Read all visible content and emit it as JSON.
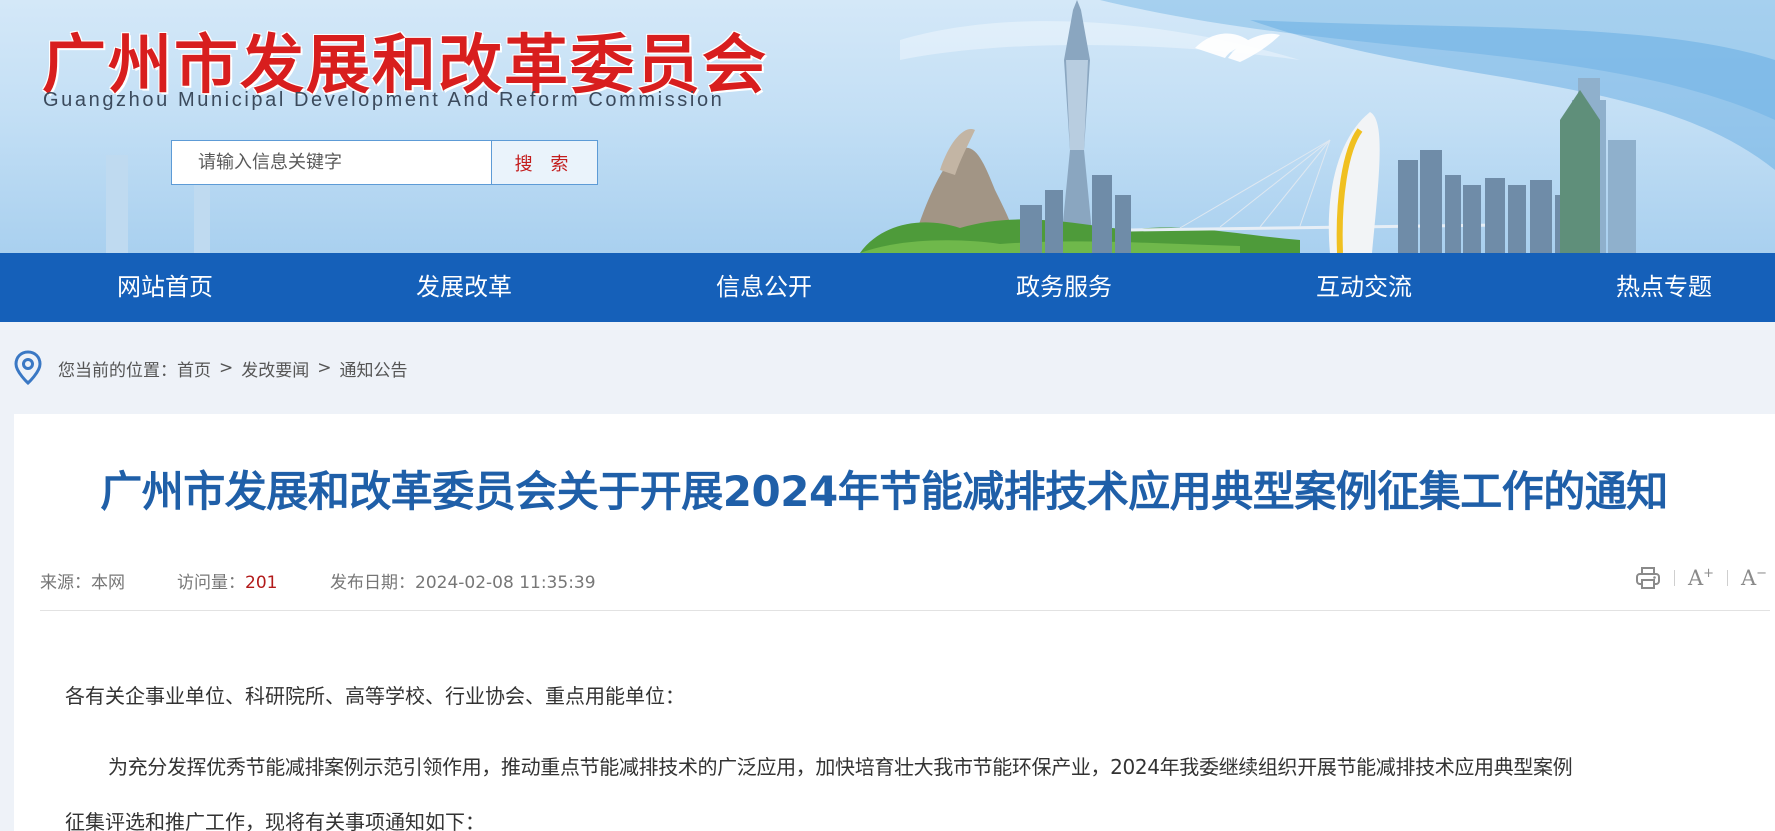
{
  "header": {
    "site_title": "广州市发展和改革委员会",
    "site_subtitle": "Guangzhou Municipal Development And Reform Commission",
    "search": {
      "placeholder": "请输入信息关键字",
      "button_label": "搜 索"
    }
  },
  "nav": {
    "items": [
      {
        "label": "网站首页"
      },
      {
        "label": "发展改革"
      },
      {
        "label": "信息公开"
      },
      {
        "label": "政务服务"
      },
      {
        "label": "互动交流"
      },
      {
        "label": "热点专题"
      }
    ]
  },
  "breadcrumb": {
    "prefix": "您当前的位置：",
    "items": [
      "首页",
      "发改要闻",
      "通知公告"
    ],
    "separator": ">"
  },
  "article": {
    "title": "广州市发展和改革委员会关于开展2024年节能减排技术应用典型案例征集工作的通知",
    "meta": {
      "source_label": "来源：",
      "source_value": "本网",
      "views_label": "访问量：",
      "views_value": "201",
      "date_label": "发布日期：",
      "date_value": "2024-02-08 11:35:39"
    },
    "tools": {
      "zoom_in": "A",
      "zoom_out": "A"
    },
    "salutation": "各有关企事业单位、科研院所、高等学校、行业协会、重点用能单位：",
    "body_line_1": "为充分发挥优秀节能减排案例示范引领作用，推动重点节能减排技术的广泛应用，加快培育壮大我市节能环保产业，2024年我委继续组织开展节能减排技术应用典型案例",
    "body_line_2": "征集评选和推广工作，现将有关事项通知如下："
  },
  "colors": {
    "nav_bg": "#1560b9",
    "title_blue": "#1f5fa8",
    "brand_red": "#d81e1e",
    "views_red": "#b21a1a"
  }
}
